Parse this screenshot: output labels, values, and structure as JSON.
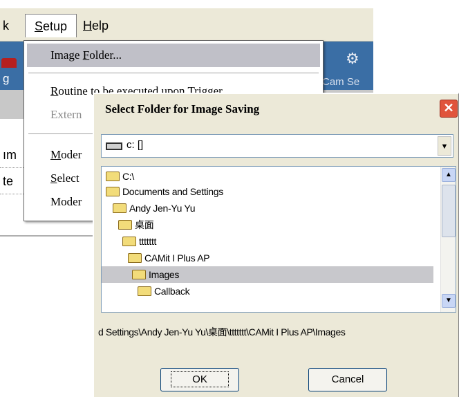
{
  "menubar": {
    "partial_item": "k",
    "setup_label": "Setup",
    "setup_mnemonic": "S",
    "setup_rest": "etup",
    "help_mnemonic": "H",
    "help_rest": "elp"
  },
  "toolbar": {
    "left_label": "g",
    "right_label": "Cam Se"
  },
  "background": {
    "row1_text": "ım",
    "row2_text": "te"
  },
  "setup_menu": {
    "items": [
      {
        "pre": "Image ",
        "mn": "F",
        "post": "older..."
      },
      {
        "pre": "",
        "mn": "R",
        "post": "outine to be executed upon Trigger"
      },
      {
        "pre": "",
        "mn": "",
        "post": "Extern"
      },
      {
        "pre": "",
        "mn": "M",
        "post": "oder"
      },
      {
        "pre": "",
        "mn": "S",
        "post": "elect"
      },
      {
        "pre": "",
        "mn": "",
        "post": "Moder"
      }
    ]
  },
  "dialog": {
    "title": "Select Folder for Image Saving",
    "close_glyph": "✕",
    "drive": "c: []",
    "drive_arrow": "▼",
    "folders": [
      "C:\\",
      "Documents and Settings",
      "Andy Jen-Yu Yu",
      "桌面",
      "ttttttt",
      "CAMit I Plus AP",
      "Images",
      "Callback"
    ],
    "selected_folder": "Images",
    "scroll_up": "▲",
    "scroll_down": "▼",
    "path": "d Settings\\Andy Jen-Yu Yu\\桌面\\ttttttt\\CAMit I Plus AP\\Images",
    "ok": "OK",
    "cancel": "Cancel"
  },
  "colors": {
    "menu_bg": "#ece9d8",
    "toolbar_bg": "#3a6ea5",
    "highlight": "#c0c0c8",
    "close_btn": "#e0543c"
  }
}
